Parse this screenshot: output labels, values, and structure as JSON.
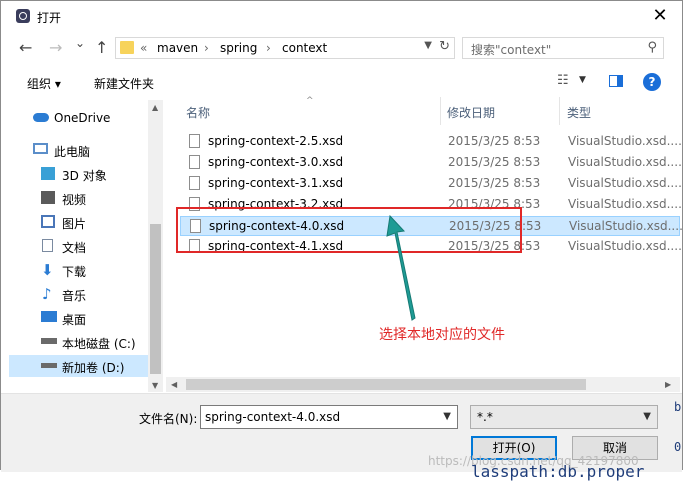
{
  "titlebar": {
    "title": "打开",
    "close": "✕"
  },
  "nav": {
    "back": "←",
    "forward": "→",
    "down": "⌄",
    "up": "↑",
    "crumbs": [
      "«",
      "maven",
      "›",
      "spring",
      "›",
      "context"
    ],
    "search_placeholder": "搜索\"context\""
  },
  "toolbar": {
    "organize": "组织 ▾",
    "new_folder": "新建文件夹",
    "help": "?"
  },
  "sidebar": {
    "items": [
      {
        "label": "OneDrive",
        "icon": "cloud-icon",
        "color": "#2b7cd3"
      },
      {
        "label": "此电脑",
        "icon": "computer-icon",
        "color": "#5b8ec9"
      },
      {
        "label": "3D 对象",
        "icon": "cube-icon",
        "color": "#39a0d6"
      },
      {
        "label": "视频",
        "icon": "video-icon",
        "color": "#5a5a5a"
      },
      {
        "label": "图片",
        "icon": "picture-icon",
        "color": "#4a76b8"
      },
      {
        "label": "文档",
        "icon": "document-icon",
        "color": "#7a8aa0"
      },
      {
        "label": "下载",
        "icon": "download-icon",
        "color": "#2b7cd3"
      },
      {
        "label": "音乐",
        "icon": "music-icon",
        "color": "#2b7cd3"
      },
      {
        "label": "桌面",
        "icon": "desktop-icon",
        "color": "#2b7cd3"
      },
      {
        "label": "本地磁盘 (C:)",
        "icon": "drive-icon",
        "color": "#6a6a6a"
      },
      {
        "label": "新加卷 (D:)",
        "icon": "drive-icon",
        "color": "#6a6a6a"
      }
    ]
  },
  "files": {
    "headers": {
      "name": "名称",
      "date": "修改日期",
      "type": "类型"
    },
    "rows": [
      {
        "name": "spring-context-2.5.xsd",
        "date": "2015/3/25 8:53",
        "type": "VisualStudio.xsd...."
      },
      {
        "name": "spring-context-3.0.xsd",
        "date": "2015/3/25 8:53",
        "type": "VisualStudio.xsd...."
      },
      {
        "name": "spring-context-3.1.xsd",
        "date": "2015/3/25 8:53",
        "type": "VisualStudio.xsd...."
      },
      {
        "name": "spring-context-3.2.xsd",
        "date": "2015/3/25 8:53",
        "type": "VisualStudio.xsd...."
      },
      {
        "name": "spring-context-4.0.xsd",
        "date": "2015/3/25 8:53",
        "type": "VisualStudio.xsd....",
        "selected": true
      },
      {
        "name": "spring-context-4.1.xsd",
        "date": "2015/3/25 8:53",
        "type": "VisualStudio.xsd...."
      }
    ]
  },
  "bottom": {
    "filename_label": "文件名(N):",
    "filename_value": "spring-context-4.0.xsd",
    "filetype_value": "*.*",
    "open_label": "打开(O)",
    "cancel_label": "取消"
  },
  "annotation": {
    "text": "选择本地对应的文件",
    "color": "#e02828"
  },
  "background": {
    "code_text": "lasspath:db.proper",
    "side_text": "b",
    "side_text_2": "0",
    "watermark": "https://blog.csdn.net/qq_42197800"
  }
}
